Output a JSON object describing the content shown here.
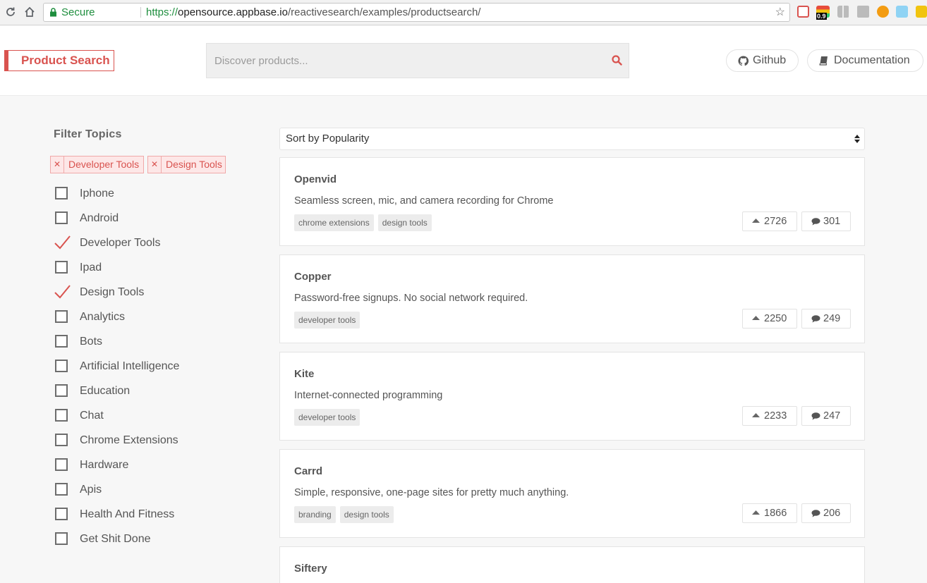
{
  "browser": {
    "secure_label": "Secure",
    "url_scheme": "https://",
    "url_host": "opensource.appbase.io",
    "url_path": "/reactivesearch/examples/productsearch/",
    "badge_text": "0.9"
  },
  "header": {
    "brand": "Product Search",
    "search_placeholder": "Discover products...",
    "github_label": "Github",
    "docs_label": "Documentation",
    "accent_color": "#d9534f"
  },
  "sidebar": {
    "title": "Filter Topics",
    "selected_tags": [
      "Developer Tools",
      "Design Tools"
    ],
    "topics": [
      {
        "label": "Iphone",
        "checked": false
      },
      {
        "label": "Android",
        "checked": false
      },
      {
        "label": "Developer Tools",
        "checked": true
      },
      {
        "label": "Ipad",
        "checked": false
      },
      {
        "label": "Design Tools",
        "checked": true
      },
      {
        "label": "Analytics",
        "checked": false
      },
      {
        "label": "Bots",
        "checked": false
      },
      {
        "label": "Artificial Intelligence",
        "checked": false
      },
      {
        "label": "Education",
        "checked": false
      },
      {
        "label": "Chat",
        "checked": false
      },
      {
        "label": "Chrome Extensions",
        "checked": false
      },
      {
        "label": "Hardware",
        "checked": false
      },
      {
        "label": "Apis",
        "checked": false
      },
      {
        "label": "Health And Fitness",
        "checked": false
      },
      {
        "label": "Get Shit Done",
        "checked": false
      }
    ]
  },
  "results": {
    "sort_label": "Sort by Popularity",
    "items": [
      {
        "name": "Openvid",
        "description": "Seamless screen, mic, and camera recording for Chrome",
        "tags": [
          "chrome extensions",
          "design tools"
        ],
        "upvotes": "2726",
        "comments": "301"
      },
      {
        "name": "Copper",
        "description": "Password-free signups. No social network required.",
        "tags": [
          "developer tools"
        ],
        "upvotes": "2250",
        "comments": "249"
      },
      {
        "name": "Kite",
        "description": "Internet-connected programming",
        "tags": [
          "developer tools"
        ],
        "upvotes": "2233",
        "comments": "247"
      },
      {
        "name": "Carrd",
        "description": "Simple, responsive, one-page sites for pretty much anything.",
        "tags": [
          "branding",
          "design tools"
        ],
        "upvotes": "1866",
        "comments": "206"
      },
      {
        "name": "Siftery",
        "description": "",
        "tags": [],
        "upvotes": "",
        "comments": ""
      }
    ]
  }
}
